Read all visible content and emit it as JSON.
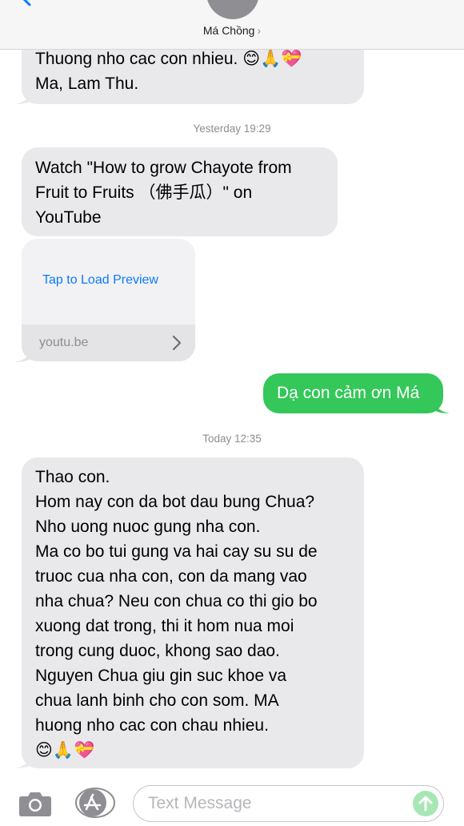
{
  "header": {
    "contact_name": "Má Chồng",
    "chevron": "›"
  },
  "colors": {
    "incoming_bubble": "#e9e9eb",
    "outgoing_bubble": "#34c759",
    "link_blue": "#0a7aff",
    "timestamp_gray": "#8e8e93"
  },
  "messages": {
    "m1": "Thuong nho cac con nhieu. 😊🙏💝\nMa, Lam Thu.",
    "ts1": "Yesterday 19:29",
    "m2": "Watch \"How to grow Chayote from\nFruit to Fruits （佛手瓜）\" on\nYouTube",
    "link_preview": {
      "cta": "Tap to Load Preview",
      "domain": "youtu.be"
    },
    "m3": "Dạ con cảm ơn Má",
    "ts2": "Today 12:35",
    "m4": "Thao con.\nHom nay con da bot dau bung Chua?\nNho uong nuoc gung nha con.\nMa co bo tui gung va hai cay su su de\ntruoc cua nha con, con da mang vao\nnha chua? Neu con chua co thi gio bo\nxuong dat trong, thi it hom nua moi\ntrong cung duoc, khong sao dao.\nNguyen Chua giu gin suc khoe va\nchua lanh binh cho con som. MA\nhuong nho cac con chau nhieu.\n😊🙏💝"
  },
  "input_bar": {
    "placeholder": "Text Message",
    "icons": [
      "camera-icon",
      "app-store-icon",
      "send-arrow-icon"
    ]
  }
}
